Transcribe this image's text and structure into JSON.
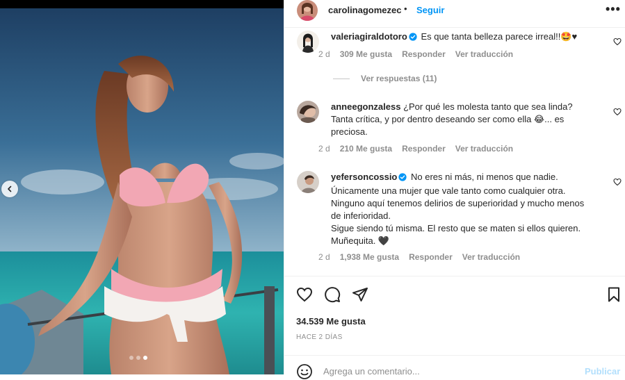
{
  "post": {
    "username": "carolinagomezec",
    "separator": "•",
    "follow_label": "Seguir",
    "more_label": "•••",
    "carousel": {
      "slide_count": 3,
      "active_index": 2
    }
  },
  "comments": [
    {
      "username": "valeriagiraldotoro",
      "verified": true,
      "text": "Es que tanta belleza parece irreal!!🤩♥",
      "time": "2 d",
      "likes": "309 Me gusta",
      "reply_label": "Responder",
      "translate_label": "Ver traducción"
    },
    {
      "username": "anneegonzaless",
      "verified": false,
      "text": "¿Por qué les molesta tanto que sea linda? Tanta crítica, y por dentro deseando ser como ella 😂... es preciosa.",
      "time": "2 d",
      "likes": "210 Me gusta",
      "reply_label": "Responder",
      "translate_label": "Ver traducción"
    },
    {
      "username": "yefersoncossio",
      "verified": true,
      "text_lines": [
        "No eres ni más, ni menos que nadie.",
        "Únicamente una mujer que vale tanto como cualquier otra.",
        "Ninguno aquí tenemos delirios de superioridad y mucho menos de inferioridad.",
        "Sigue siendo tú misma. El resto que se maten si ellos quieren.",
        "Muñequita. 🖤"
      ],
      "time": "2 d",
      "likes": "1,938 Me gusta",
      "reply_label": "Responder",
      "translate_label": "Ver traducción"
    }
  ],
  "view_replies": "Ver respuestas (11)",
  "likes_total": "34.539 Me gusta",
  "posted_ago": "HACE 2 DÍAS",
  "comment_box": {
    "placeholder": "Agrega un comentario...",
    "publish_label": "Publicar"
  },
  "colors": {
    "link_blue": "#0095f6",
    "muted": "#8e8e8e",
    "text": "#262626",
    "publish_disabled": "#b2dffc",
    "sea": "#2fb3b0",
    "sky": "#2f5f86"
  }
}
